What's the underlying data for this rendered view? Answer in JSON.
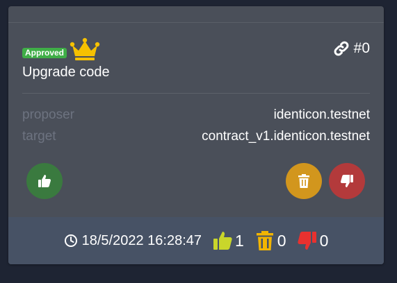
{
  "proposal": {
    "status_badge": "Approved",
    "title": "Upgrade code",
    "id_label": "#0"
  },
  "details": [
    {
      "label": "proposer",
      "value": "identicon.testnet"
    },
    {
      "label": "target",
      "value": "contract_v1.identicon.testnet"
    }
  ],
  "footer": {
    "timestamp": "18/5/2022 16:28:47",
    "approve_count": "1",
    "remove_count": "0",
    "reject_count": "0"
  },
  "colors": {
    "approved_badge": "#3fae47",
    "crown": "#f6c100",
    "approve": "#3a7a3f",
    "remove": "#d2961d",
    "reject": "#b33a3b",
    "footer_approve": "#c9d62b",
    "footer_remove": "#f2b500",
    "footer_reject": "#e8312f"
  },
  "icons": {
    "crown": "crown-icon",
    "link": "link-icon",
    "approve": "thumbs-up-icon",
    "remove": "trash-icon",
    "reject": "thumbs-down-icon",
    "clock": "clock-icon"
  }
}
